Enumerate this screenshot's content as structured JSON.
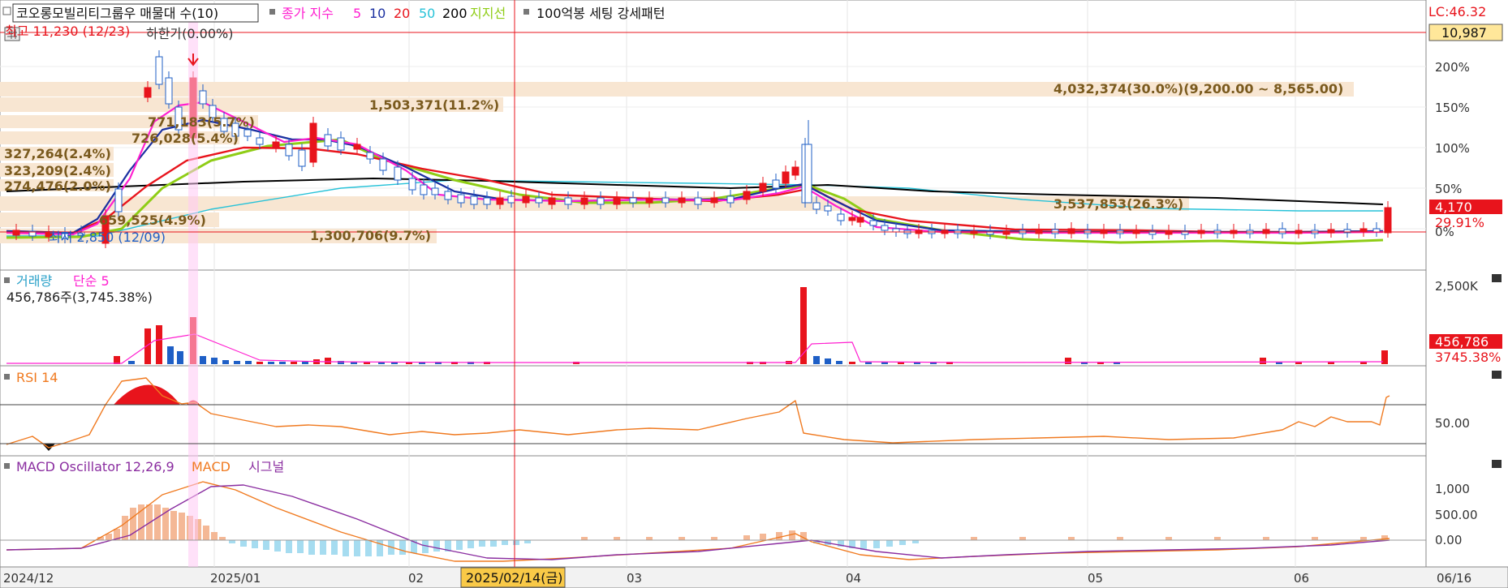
{
  "price_panel": {
    "legend": {
      "stock_name": "코오롱모빌리티그룹우 매물대 수(10)",
      "ma_label": "종가 지수",
      "ma_periods": [
        "5",
        "10",
        "20",
        "50",
        "200"
      ],
      "support_label": "지지선",
      "setting_label": "100억봉 세팅 강세패턴"
    },
    "high_note": "최고 11,230 (12/23)",
    "limit_note": "하한가(0.00%)",
    "low_note": "최저 2,850 (12/09)",
    "lc_label": "LC:46.32",
    "ref_price_badge": "10,987",
    "current_price_badge": "4,170",
    "change_pct": "29.91%",
    "y_ticks": [
      "200%",
      "150%",
      "100%",
      "50%",
      "0%"
    ],
    "volume_profile": [
      {
        "label": "4,032,374(30.0%)(9,200.00 ~ 8,565.00)"
      },
      {
        "label": "1,503,371(11.2%)"
      },
      {
        "label": "771,183(5.7%)"
      },
      {
        "label": "726,028(5.4%)"
      },
      {
        "label": "327,264(2.4%)"
      },
      {
        "label": "323,209(2.4%)"
      },
      {
        "label": "274,476(2.0%)"
      },
      {
        "label": "3,537,853(26.3%)"
      },
      {
        "label": "659,525(4.9%)"
      },
      {
        "label": "1,300,706(9.7%)"
      }
    ]
  },
  "volume_panel": {
    "legend_title": "거래량",
    "legend_ma": "단순 5",
    "value_note": "456,786주(3,745.38%)",
    "y_tick": "2,500K",
    "badge_value": "456,786",
    "badge_pct": "3745.38%"
  },
  "rsi_panel": {
    "legend": "RSI 14",
    "y_tick": "50.00"
  },
  "macd_panel": {
    "legend_osc": "MACD Oscillator 12,26,9",
    "legend_macd": "MACD",
    "legend_signal": "시그널",
    "y_ticks": [
      "1,000",
      "500.00",
      "0.00"
    ]
  },
  "x_axis": {
    "labels": [
      "2024/12",
      "2025/01",
      "02",
      "03",
      "04",
      "05",
      "06"
    ],
    "cursor_label": "2025/02/14(금)",
    "last_label": "06/16"
  },
  "colors": {
    "up": "#e8141c",
    "down": "#1f5fc6",
    "ma5": "#ff1fd0",
    "ma10": "#1a2fa0",
    "ma20": "#e8141c",
    "ma50": "#27c2d8",
    "ma200": "#000000",
    "support": "#8fcd16",
    "profile": "#f8e6d2",
    "profile_text": "#7a5a1e",
    "rsi": "#f07a20",
    "macd": "#f07a20",
    "signal": "#8a2da0",
    "osc_pos": "#f4b896",
    "osc_neg": "#a6dcf0",
    "highlight": "#ffc9f4"
  },
  "chart_data": {
    "type": "candlestick",
    "title": "코오롱모빌리티그룹우",
    "price_extremes": {
      "high": 11230,
      "high_date": "12/23",
      "low": 2850,
      "low_date": "12/09"
    },
    "current": {
      "price": 4170,
      "change_pct": 29.91,
      "volume": 456786,
      "volume_pct": 3745.38
    },
    "x_range": [
      "2024/12",
      "06/16"
    ],
    "series": [
      {
        "name": "종가 지수 5"
      },
      {
        "name": "10"
      },
      {
        "name": "20"
      },
      {
        "name": "50"
      },
      {
        "name": "200"
      },
      {
        "name": "지지선"
      }
    ]
  }
}
